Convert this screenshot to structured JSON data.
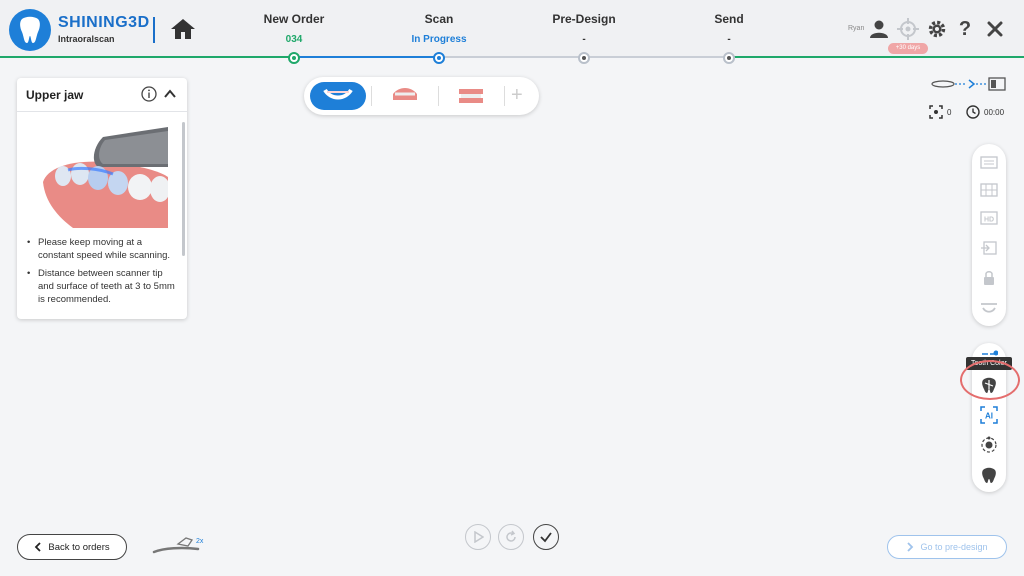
{
  "header": {
    "brand": "SHINING3D",
    "brand_sub": "Intraoralscan",
    "steps": [
      {
        "title": "New Order",
        "sub": "034",
        "color": "#1fa86a"
      },
      {
        "title": "Scan",
        "sub": "In Progress",
        "color": "#1e7fd8"
      },
      {
        "title": "Pre-Design",
        "sub": "-",
        "color": "#333333"
      },
      {
        "title": "Send",
        "sub": "-",
        "color": "#333333"
      }
    ],
    "user": "Ryan",
    "trial_badge": "+30 days",
    "icons": [
      "home-icon",
      "user-icon",
      "crosshair-icon",
      "gear-icon",
      "help-icon",
      "close-icon"
    ]
  },
  "panel": {
    "title": "Upper jaw",
    "tips": [
      "Please keep moving at a constant speed while scanning.",
      "Distance between scanner tip and surface of teeth at 3 to 5mm is recommended."
    ]
  },
  "jaw_selector": {
    "options": [
      "upper-jaw",
      "lower-jaw",
      "bite"
    ],
    "selected": "upper-jaw"
  },
  "status": {
    "shot_count": "0",
    "timer": "00:00"
  },
  "toolbar": {
    "tooltip": "Tooth Color",
    "top_tools": [
      "texture-icon",
      "grid-icon",
      "hd-icon",
      "import-icon",
      "lock-icon",
      "arch-icon"
    ],
    "bottom_tools": [
      "scan-strategy-icon",
      "tooth-color-icon",
      "ai-icon",
      "orbit-icon",
      "tooth-tool-icon"
    ]
  },
  "bottom": {
    "back_label": "Back to orders",
    "scanner_badge": "2x",
    "predesign_label": "Go to pre-design"
  },
  "colors": {
    "accent": "#1e7fd8",
    "green": "#1fa86a",
    "highlight": "#e46d6d"
  }
}
